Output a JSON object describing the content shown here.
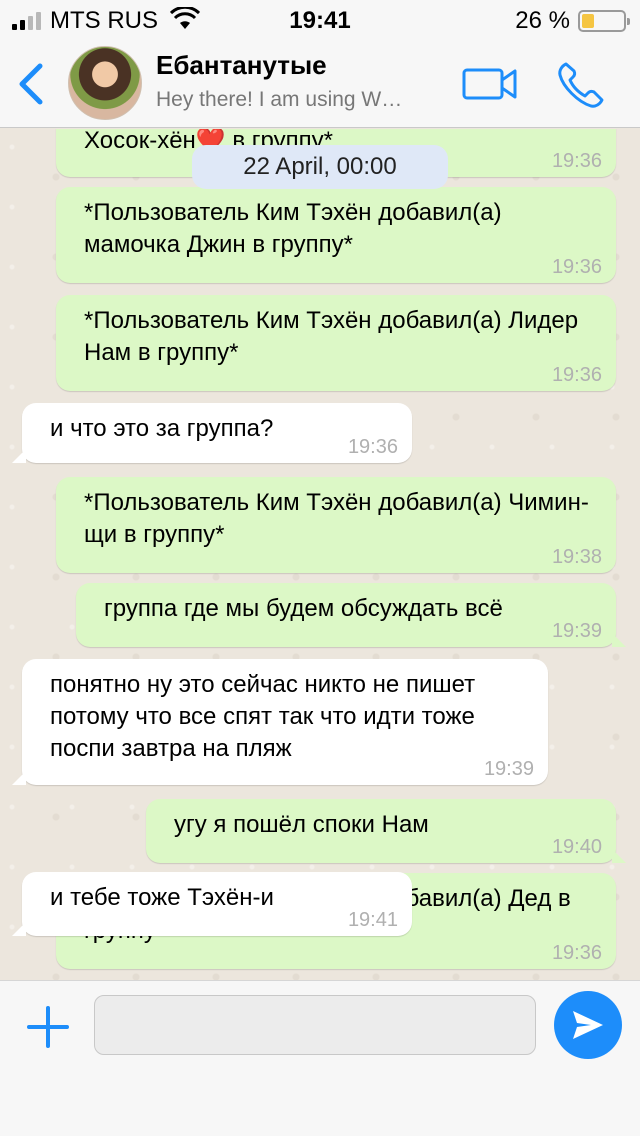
{
  "status_bar": {
    "carrier": "MTS RUS",
    "time": "19:41",
    "battery_percent": "26 %",
    "battery_level": 0.26,
    "signal_bars": 2
  },
  "header": {
    "back_icon": "chevron-left-icon",
    "title": "Ебантанутые",
    "subtitle": "Hey there! I am using W…",
    "video_icon": "video-camera-icon",
    "call_icon": "phone-icon"
  },
  "date_pill": "22 April, 00:00",
  "messages": [
    {
      "dir": "out",
      "text": "Хосок-хён❤️ в группу*",
      "time": "19:36"
    },
    {
      "dir": "out",
      "text": "*Пользователь Ким Тэхён добавил(а) мамочка Джин в группу*",
      "time": "19:36"
    },
    {
      "dir": "out",
      "text": "*Пользователь Ким Тэхён добавил(а) Лидер Нам в группу*",
      "time": "19:36"
    },
    {
      "dir": "in",
      "text": "и что это за группа?",
      "time": "19:36"
    },
    {
      "dir": "out",
      "text": "*Пользователь Ким Тэхён добавил(а) Чимин-щи в группу*",
      "time": "19:38"
    },
    {
      "dir": "out",
      "text": "группа где мы будем обсуждать всё",
      "time": "19:39"
    },
    {
      "dir": "in",
      "text": "понятно ну это сейчас никто не пишет потому что все спят так что идти тоже поспи завтра на пляж",
      "time": "19:39"
    },
    {
      "dir": "out",
      "text": "угу я пошёл споки Нам",
      "time": "19:40"
    },
    {
      "dir": "out",
      "text": "*Пользователь Ким Тэхён добавил(а) Дед в группу*",
      "time": "19:36"
    },
    {
      "dir": "in",
      "text": "и тебе тоже Тэхён-и",
      "time": "19:41"
    }
  ],
  "input_bar": {
    "plus_icon": "plus-icon",
    "placeholder": "",
    "value": "",
    "send_icon": "send-icon",
    "accent": "#1d8dfa"
  }
}
